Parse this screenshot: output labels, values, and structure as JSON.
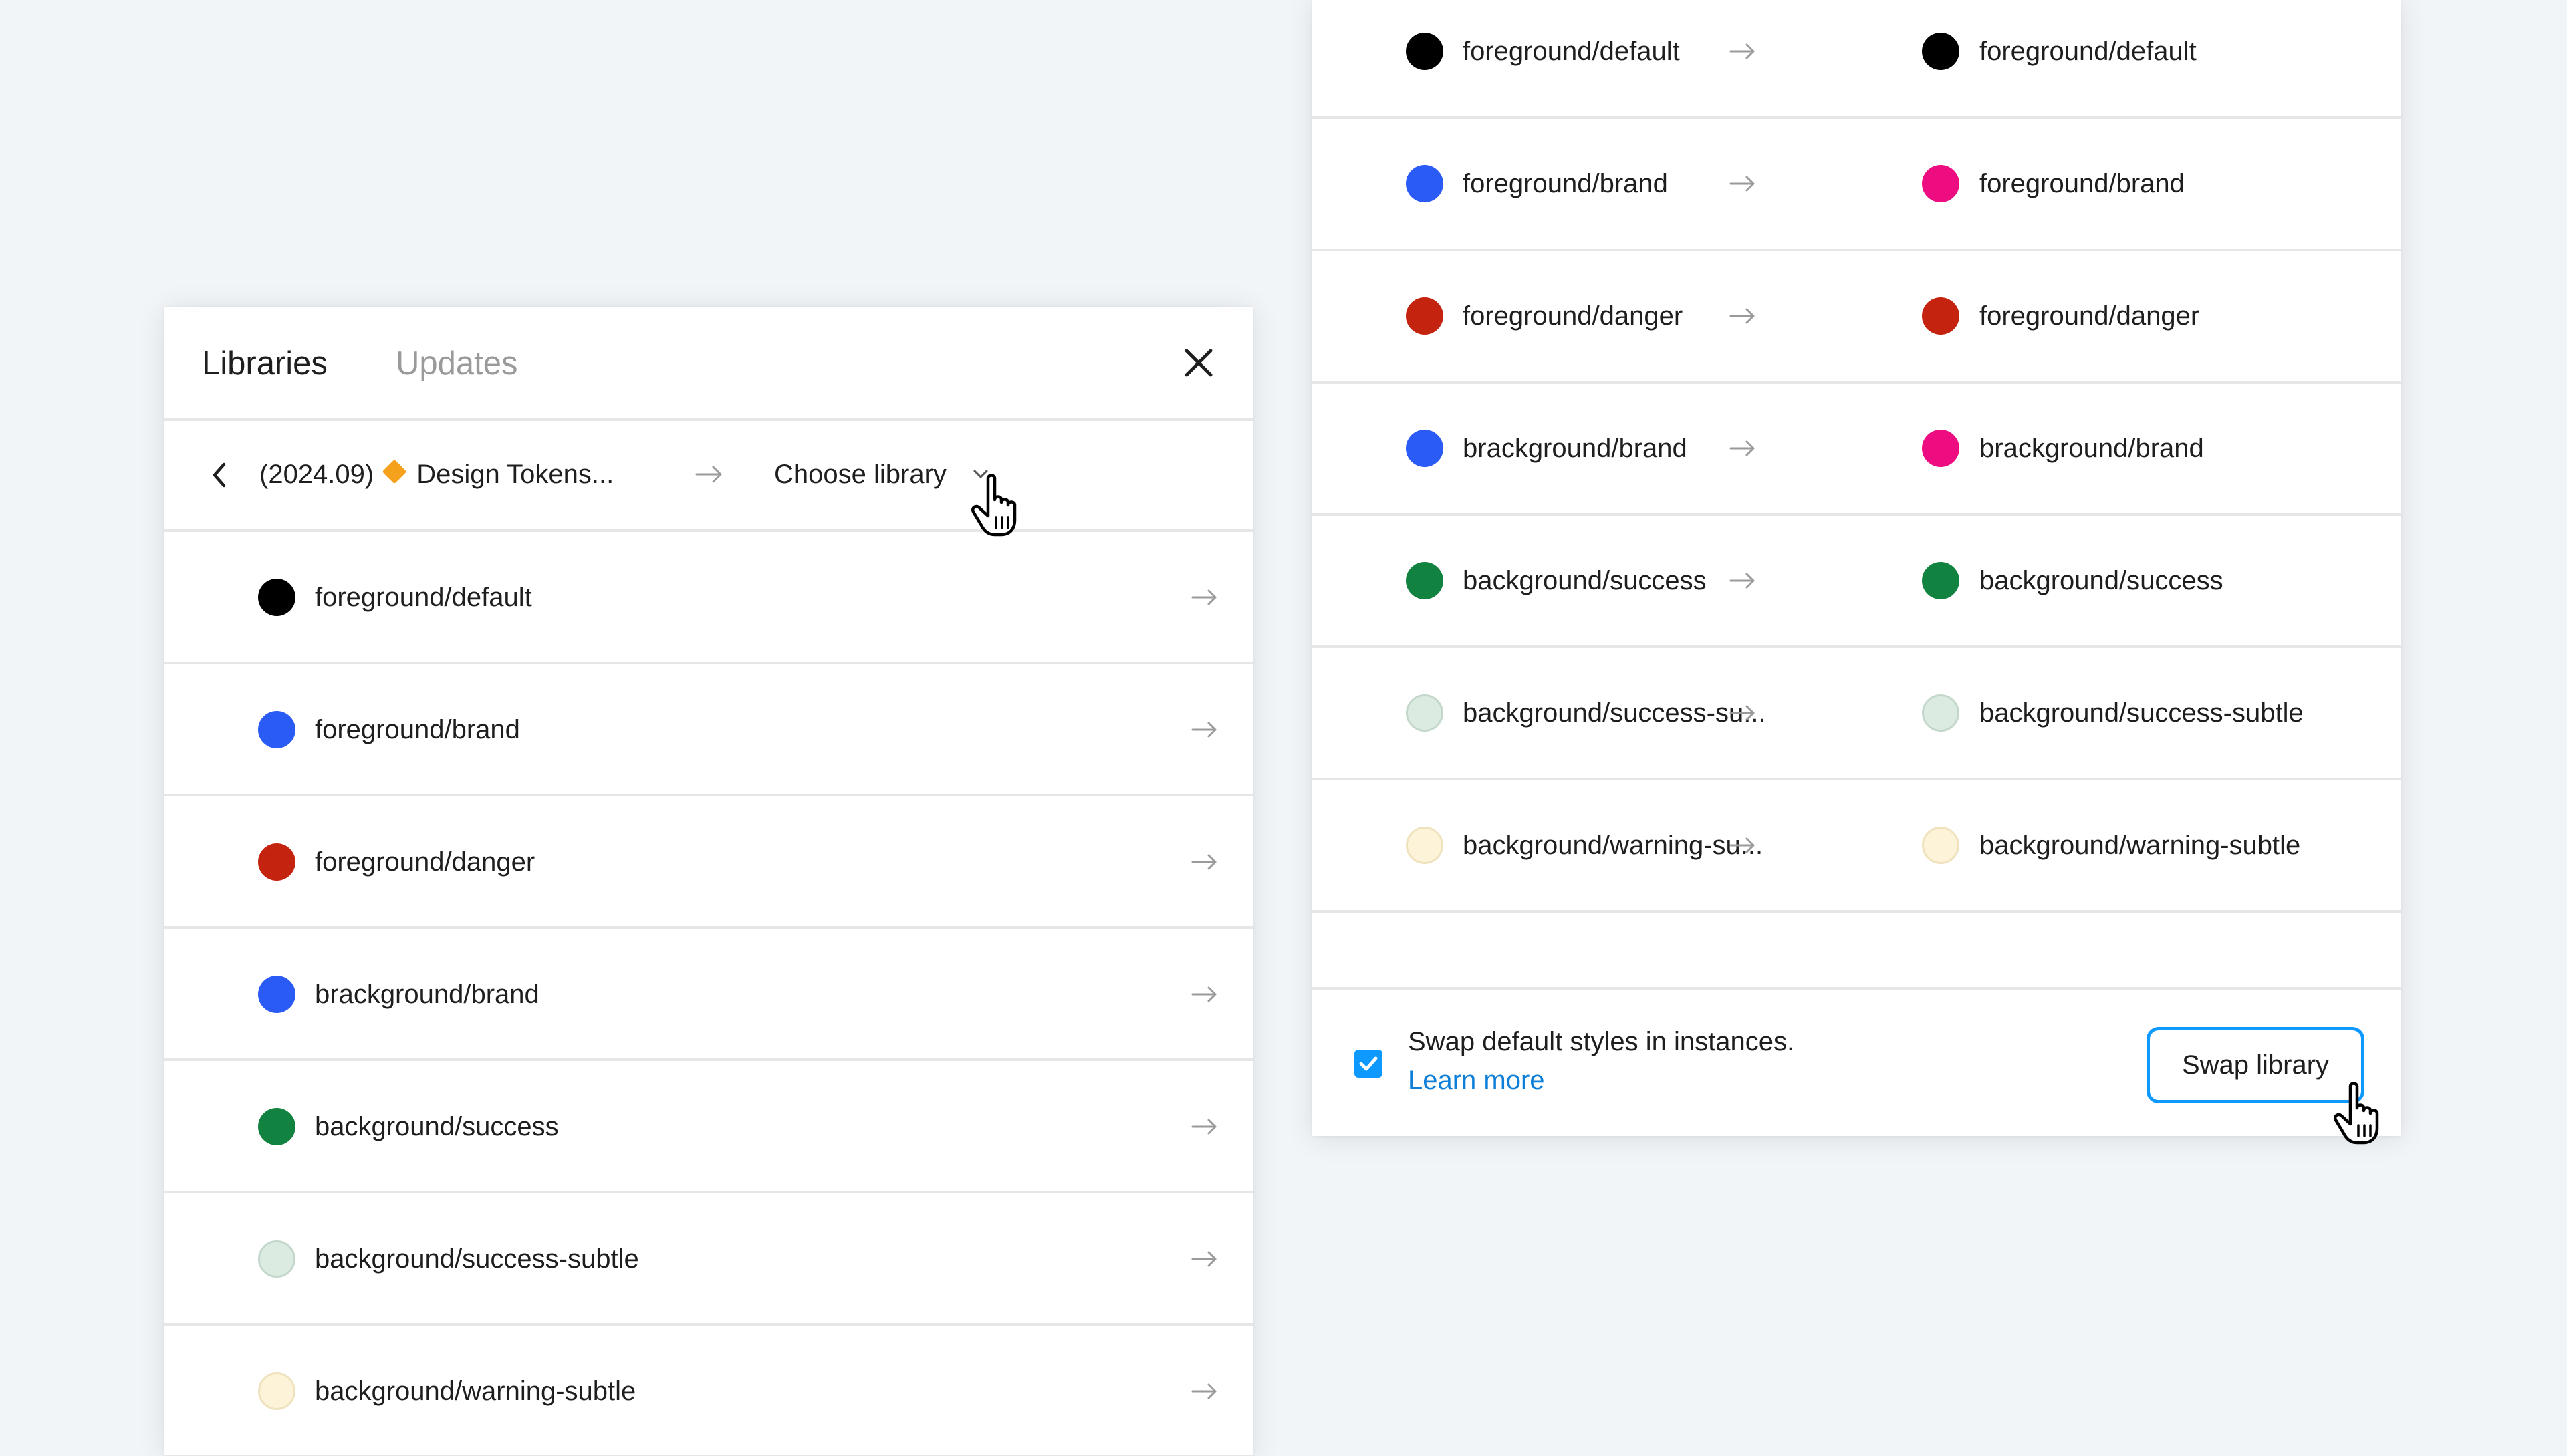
{
  "left_panel": {
    "tabs": [
      {
        "label": "Libraries",
        "active": true
      },
      {
        "label": "Updates",
        "active": false
      }
    ],
    "source_library": "(2024.09)",
    "source_library_name": "Design Tokens...",
    "target_library_placeholder": "Choose library",
    "rows": [
      {
        "label": "foreground/default",
        "color": "#000000"
      },
      {
        "label": "foreground/brand",
        "color": "#2b5bf5"
      },
      {
        "label": "foreground/danger",
        "color": "#c4230f"
      },
      {
        "label": "brackground/brand",
        "color": "#2b5bf5"
      },
      {
        "label": "background/success",
        "color": "#128240"
      },
      {
        "label": "background/success-subtle",
        "color": "#dcebe2"
      },
      {
        "label": "background/warning-subtle",
        "color": "#fdf3d9"
      }
    ]
  },
  "right_panel": {
    "rows": [
      {
        "from_label": "foreground/default",
        "from_color": "#000000",
        "to_label": "foreground/default",
        "to_color": "#000000"
      },
      {
        "from_label": "foreground/brand",
        "from_color": "#2b5bf5",
        "to_label": "foreground/brand",
        "to_color": "#ee0d80"
      },
      {
        "from_label": "foreground/danger",
        "from_color": "#c4230f",
        "to_label": "foreground/danger",
        "to_color": "#c4230f"
      },
      {
        "from_label": "brackground/brand",
        "from_color": "#2b5bf5",
        "to_label": "brackground/brand",
        "to_color": "#ee0d80"
      },
      {
        "from_label": "background/success",
        "from_color": "#128240",
        "to_label": "background/success",
        "to_color": "#128240"
      },
      {
        "from_label": "background/success-su...",
        "from_color": "#dcebe2",
        "to_label": "background/success-subtle",
        "to_color": "#dcebe2"
      },
      {
        "from_label": "background/warning-su...",
        "from_color": "#fdf3d9",
        "to_label": "background/warning-subtle",
        "to_color": "#fdf3d9"
      }
    ],
    "footer": {
      "checkbox_checked": true,
      "swap_text": "Swap default styles in instances.",
      "learn_more": "Learn more",
      "swap_button": "Swap library"
    }
  },
  "colors": {
    "accent": "#0d99ff",
    "link": "#0d7fd8",
    "background": "#f2f5f8",
    "divider": "#e6e6e6"
  },
  "icons": [
    "close-icon",
    "chevron-left-icon",
    "diamond-icon",
    "arrow-right-icon",
    "chevron-down-icon",
    "check-icon",
    "hand-cursor-icon"
  ]
}
